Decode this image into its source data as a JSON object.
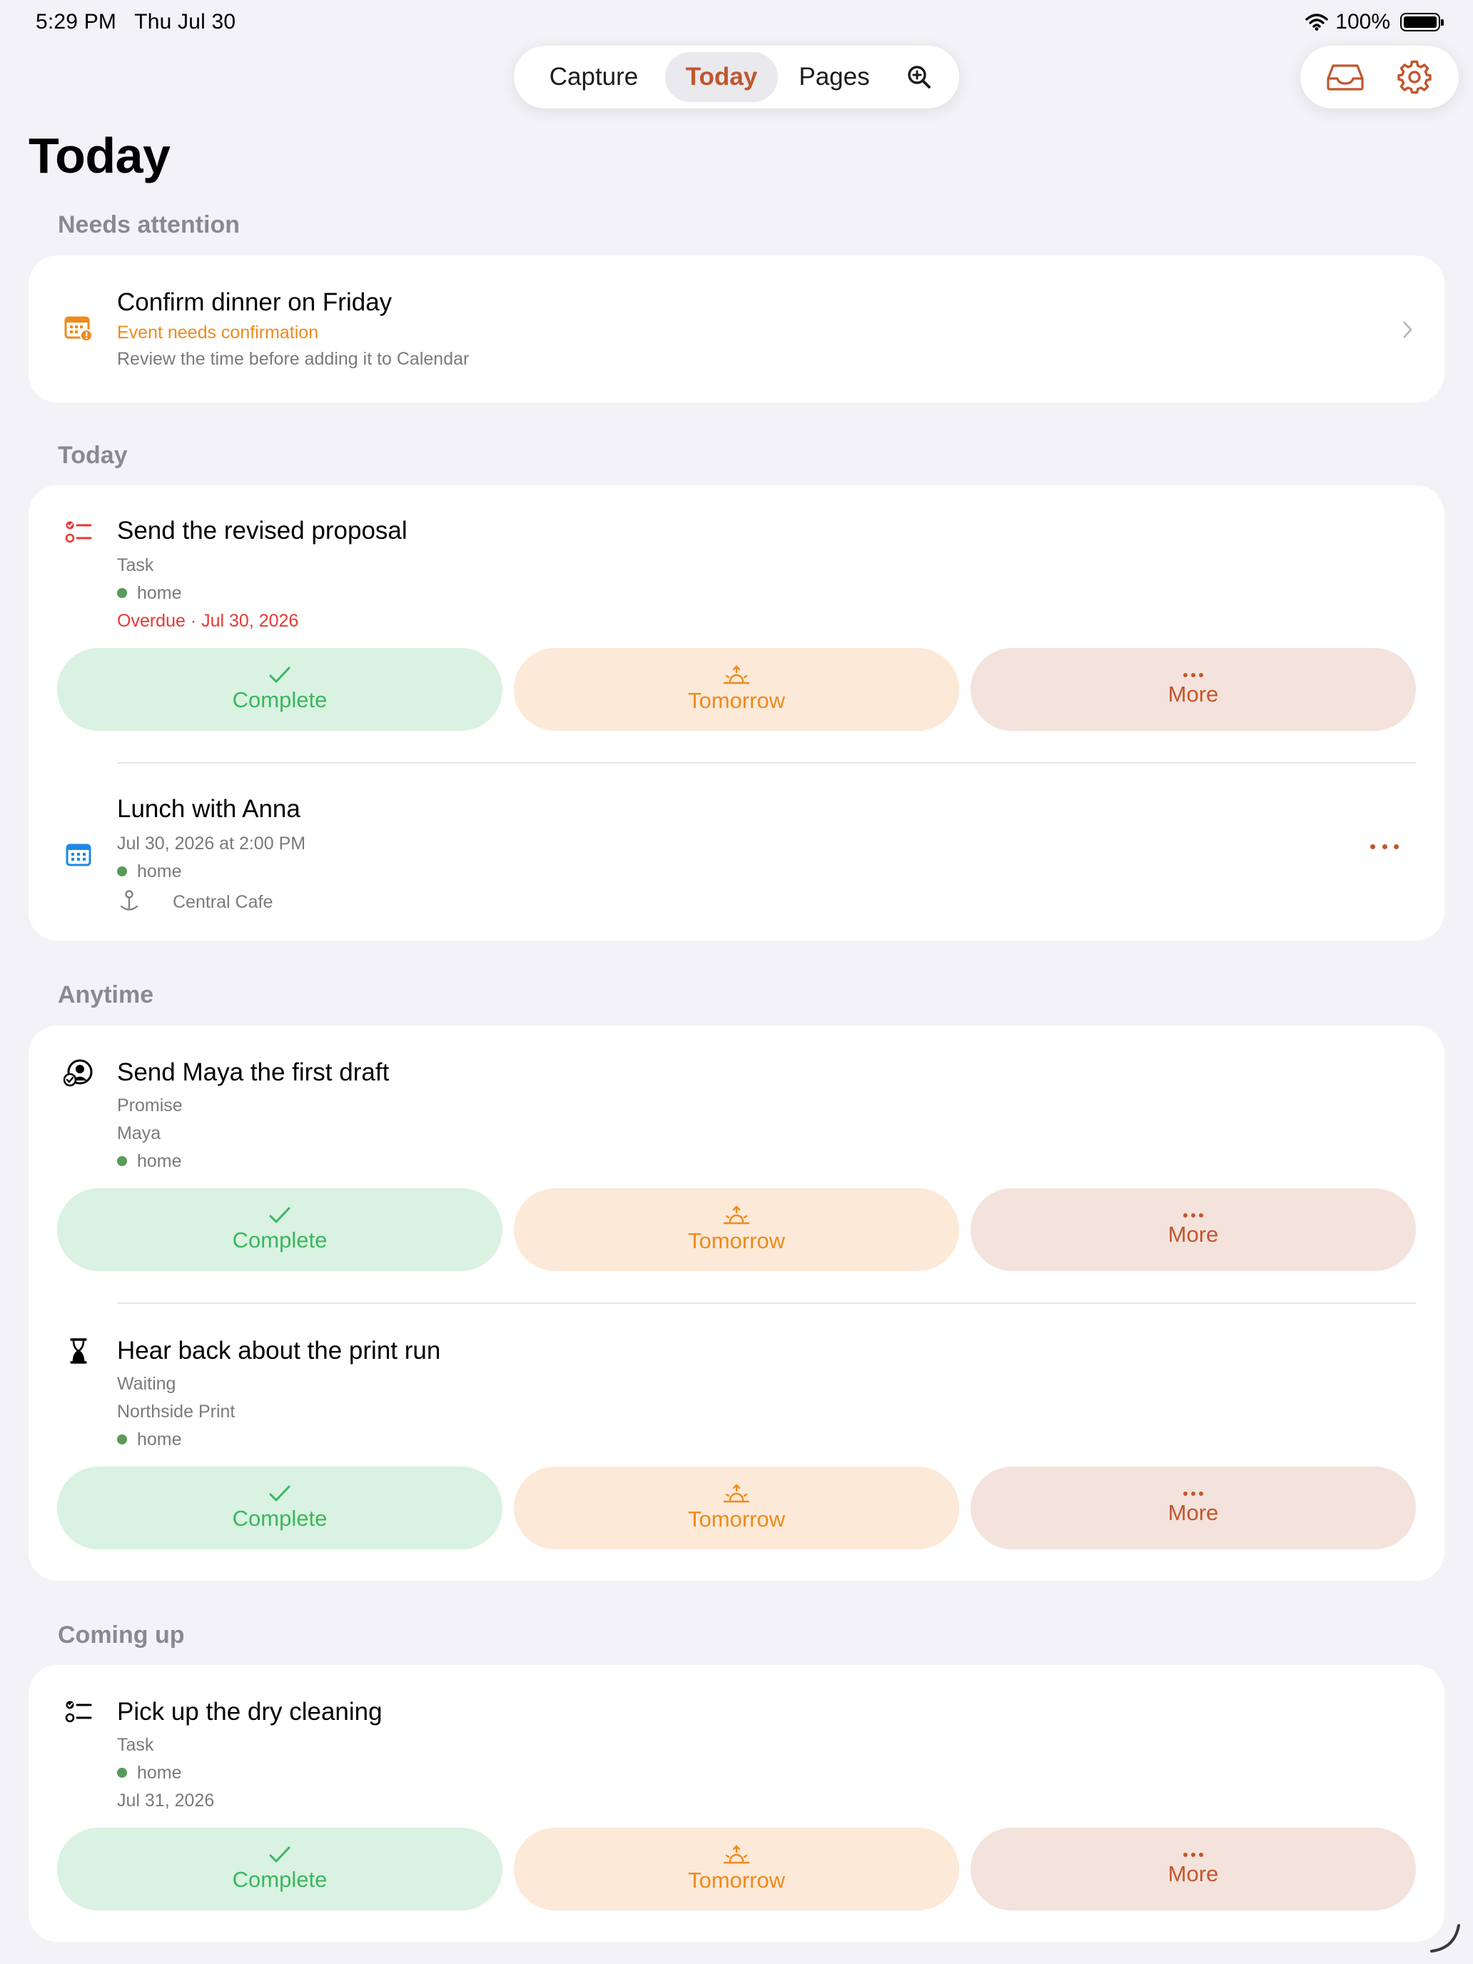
{
  "status_bar": {
    "time": "5:29 PM",
    "date": "Thu Jul 30",
    "battery": "100%"
  },
  "top_nav": {
    "tabs": [
      "Capture",
      "Today",
      "Pages"
    ],
    "active": "Today",
    "search_icon": "search-icon"
  },
  "top_actions": {
    "inbox_icon": "inbox-icon",
    "settings_icon": "gear-icon"
  },
  "page": {
    "title": "Today"
  },
  "colors": {
    "accent": "#c2562c",
    "complete_bg": "#d9f2e1",
    "complete_fg": "#3cb660",
    "tomorrow_bg": "#fde9d8",
    "tomorrow_fg": "#ef8a1c",
    "more_bg": "#f4e2dc",
    "more_fg": "#c2562c",
    "overdue": "#e53935",
    "warning": "#ef8a1c",
    "tag_dot": "#5a9a5a"
  },
  "actions": {
    "complete": "Complete",
    "tomorrow": "Tomorrow",
    "more": "More"
  },
  "sections": {
    "needs_attention": {
      "header": "Needs attention",
      "item": {
        "title": "Confirm dinner on Friday",
        "status": "Event needs confirmation",
        "detail": "Review the time before adding it to Calendar",
        "icon": "calendar-alert-icon"
      }
    },
    "today": {
      "header": "Today",
      "items": [
        {
          "title": "Send the revised proposal",
          "kind": "Task",
          "tag": "home",
          "due": "Overdue · Jul 30, 2026",
          "icon": "task-list-icon"
        },
        {
          "title": "Lunch with Anna",
          "when": "Jul 30, 2026 at 2:00 PM",
          "tag": "home",
          "location": "Central Cafe",
          "icon": "calendar-icon"
        }
      ]
    },
    "anytime": {
      "header": "Anytime",
      "items": [
        {
          "title": "Send Maya the first draft",
          "kind": "Promise",
          "person": "Maya",
          "tag": "home",
          "icon": "promise-icon"
        },
        {
          "title": "Hear back about the print run",
          "kind": "Waiting",
          "person": "Northside Print",
          "tag": "home",
          "icon": "hourglass-icon"
        }
      ]
    },
    "coming_up": {
      "header": "Coming up",
      "items": [
        {
          "title": "Pick up the dry cleaning",
          "kind": "Task",
          "tag": "home",
          "due": "Jul 31, 2026",
          "icon": "task-list-icon"
        }
      ]
    }
  }
}
